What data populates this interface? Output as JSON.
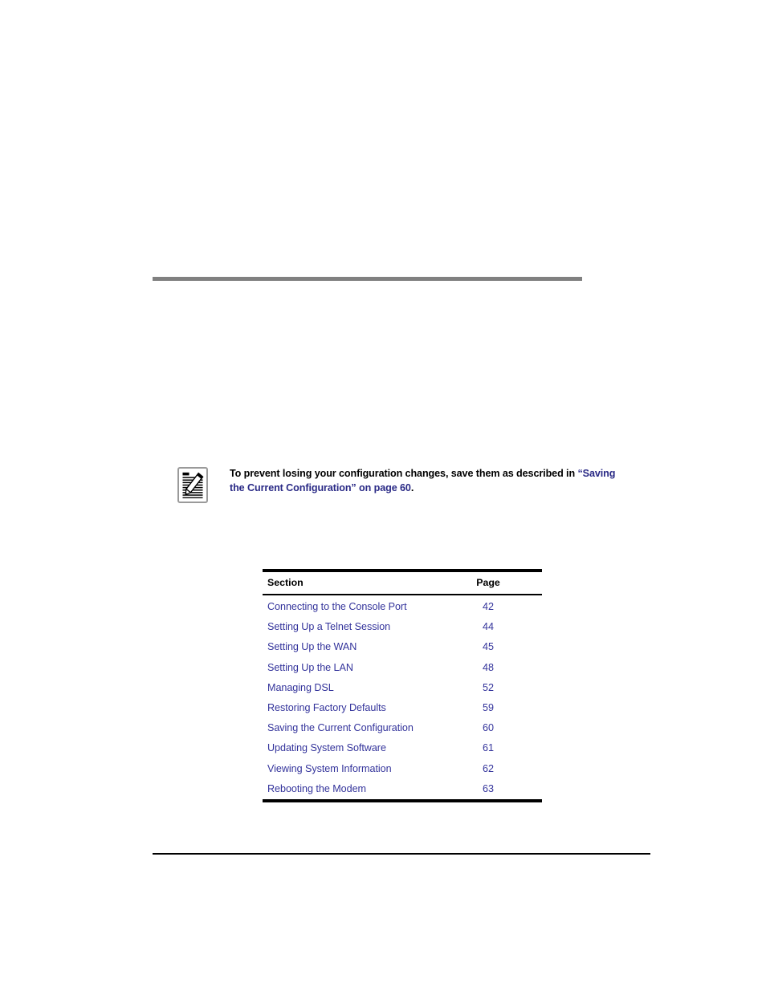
{
  "note": {
    "icon": "notepad-pencil-icon",
    "text_before": "To prevent losing your configuration changes, save them as described in ",
    "xref_open_quote": "“Saving the",
    "xref_line2": "Current Configuration” on page 60",
    "text_after": ".",
    "xref_color": "#2a2a86"
  },
  "section_table": {
    "headers": {
      "section": "Section",
      "page": "Page"
    },
    "rows": [
      {
        "section": "Connecting to the Console Port",
        "page": "42"
      },
      {
        "section": "Setting Up a Telnet Session",
        "page": "44"
      },
      {
        "section": "Setting Up the WAN",
        "page": "45"
      },
      {
        "section": "Setting Up the LAN",
        "page": "48"
      },
      {
        "section": "Managing DSL",
        "page": "52"
      },
      {
        "section": "Restoring Factory Defaults",
        "page": "59"
      },
      {
        "section": "Saving the Current Configuration",
        "page": "60"
      },
      {
        "section": "Updating System Software",
        "page": "61"
      },
      {
        "section": "Viewing System Information",
        "page": "62"
      },
      {
        "section": "Rebooting the Modem",
        "page": "63"
      }
    ],
    "link_color": "#33339b"
  },
  "rules": {
    "top_rule_color": "#808080",
    "bottom_rule_color": "#000000"
  }
}
